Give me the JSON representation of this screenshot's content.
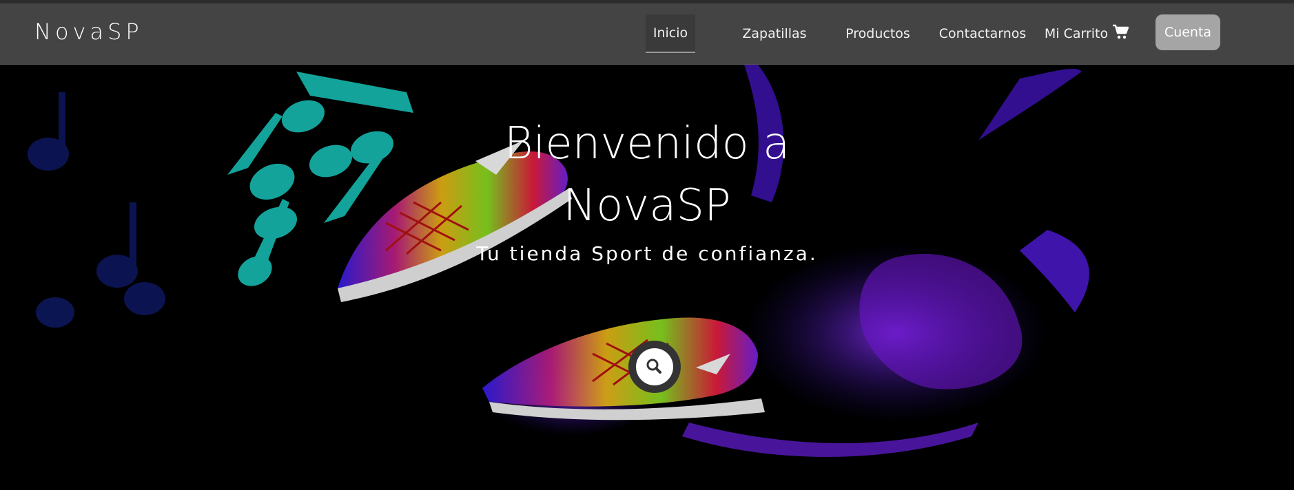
{
  "brand": "NovaSP",
  "nav": {
    "items": [
      {
        "label": "Inicio",
        "active": true
      },
      {
        "label": "Zapatillas",
        "active": false
      },
      {
        "label": "Productos",
        "active": false
      },
      {
        "label": "Contactarnos",
        "active": false
      },
      {
        "label": "Mi Carrito",
        "active": false
      }
    ],
    "cart_icon": "shopping-cart-icon",
    "account_label": "Cuenta"
  },
  "hero": {
    "title_line1": "Bienvenido a",
    "title_line2": "NovaSP",
    "subtitle": "Tu tienda Sport de confianza.",
    "search_icon": "search-icon"
  },
  "colors": {
    "navbar": "#444444",
    "hero_bg": "#000000",
    "accent_teal": "#14a39a",
    "accent_purple": "#6b1fd1",
    "account_button": "#a5a5a5"
  }
}
